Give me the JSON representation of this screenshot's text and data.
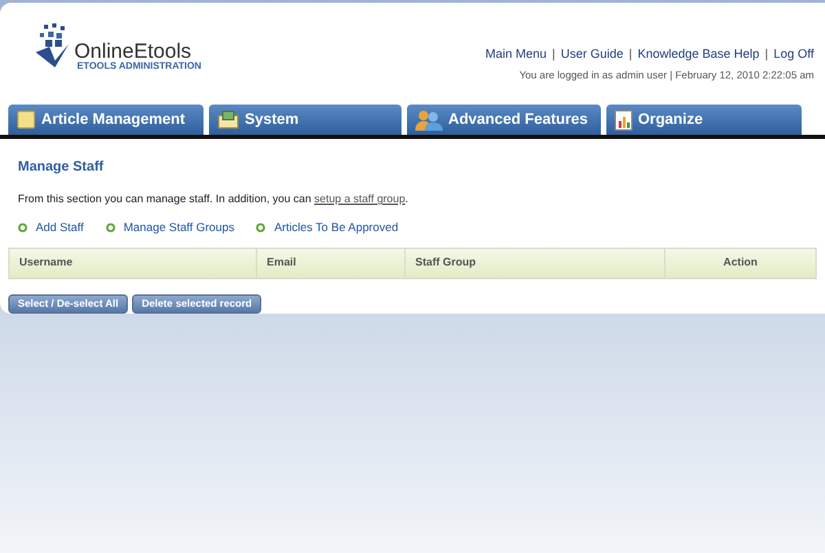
{
  "logo": {
    "name": "OnlineEtools",
    "subtitle": "ETOOLS ADMINISTRATION"
  },
  "top_links": [
    {
      "kind": "link",
      "text": "Main Menu"
    },
    {
      "kind": "separator",
      "text": "|"
    },
    {
      "kind": "link",
      "text": "User Guide"
    },
    {
      "kind": "separator",
      "text": "|"
    },
    {
      "kind": "link",
      "text": "Knowledge Base Help"
    },
    {
      "kind": "separator",
      "text": "|"
    },
    {
      "kind": "link",
      "text": "Log Off"
    }
  ],
  "status": "You are logged in as admin user | February 12, 2010 2:22:05 am",
  "tabs": [
    {
      "label": "Article Management"
    },
    {
      "label": "System"
    },
    {
      "label": "Advanced Features"
    },
    {
      "label": "Organize"
    }
  ],
  "heading": "Manage Staff",
  "intro": {
    "before": "From this section you can manage staff. In addition, you can ",
    "link": "setup a staff group",
    "after": "."
  },
  "actions": [
    "Add Staff",
    "Manage Staff Groups",
    "Articles To Be Approved"
  ],
  "table": {
    "columns": [
      "Username",
      "Email",
      "Staff Group",
      "Action"
    ]
  },
  "buttons": [
    "Select / De-select All",
    "Delete selected record"
  ]
}
